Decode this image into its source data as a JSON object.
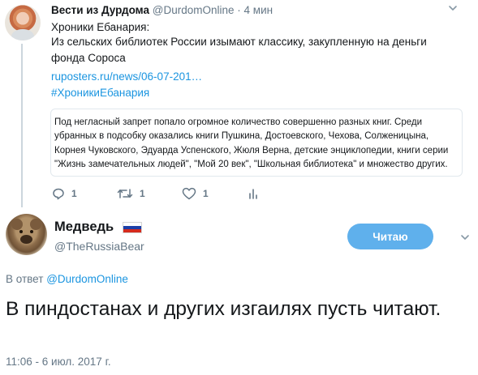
{
  "parent_tweet": {
    "author_name": "Вести из Дурдома",
    "handle": "@DurdomOnline",
    "separator": "·",
    "time": "4 мин",
    "lines": [
      "Хроники Ебанария:",
      "Из сельских библиотек России изымают классику, закупленную на деньги",
      "фонда Сороса"
    ],
    "link": "ruposters.ru/news/06-07-201…",
    "hashtag": "#ХроникиЕбанария",
    "quote_card_lines": [
      "Под негласный запрет попало огромное количество совершенно разных книг. Среди",
      "убранных в подсобку оказались книги Пушкина, Достоевского, Чехова, Солженицына,",
      "Корнея Чуковского, Эдуарда Успенского, Жюля Верна, детские энциклопедии, книги серии",
      "\"Жизнь замечательных людей\", \"Мой 20 век\", \"Школьная библиотека\" и множество других."
    ],
    "actions": {
      "reply_count": "1",
      "retweet_count": "1",
      "like_count": "1"
    }
  },
  "main_tweet": {
    "author_name": "Медведь",
    "handle": "@TheRussiaBear",
    "follow_label": "Читаю",
    "reply_prefix": "В ответ",
    "reply_to": "@DurdomOnline",
    "text": "В пиндостанах и других изгаилях пусть читают.",
    "timestamp": "11:06 - 6 июл. 2017 г."
  },
  "icons": {
    "parent_avatar": "parent-avatar-photo",
    "caret": "chevron-down-icon",
    "reply": "reply-icon",
    "retweet": "retweet-icon",
    "like": "heart-icon",
    "analytics": "analytics-icon",
    "flag": "russia-flag-icon",
    "bear_avatar": "bear-avatar-photo"
  },
  "colors": {
    "link": "#1b95e0",
    "secondary_text": "#657786",
    "follow_button": "#5fb0ec",
    "primary_text": "#14171a",
    "border": "#e1e8ed"
  }
}
